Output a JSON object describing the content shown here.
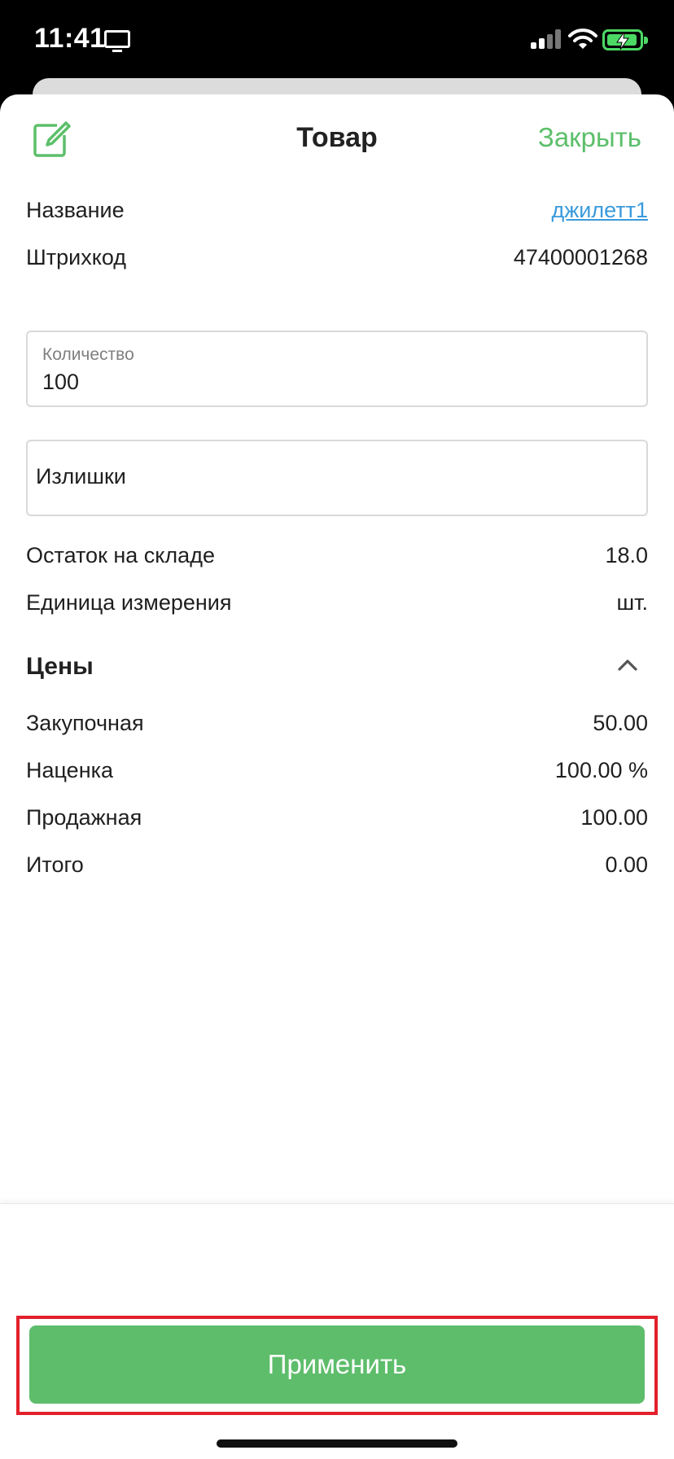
{
  "status_bar": {
    "time": "11:41",
    "battery_color": "#4cd964"
  },
  "header": {
    "title": "Товар",
    "close_label": "Закрыть",
    "accent_color": "#5cbf6a"
  },
  "product": {
    "name_label": "Название",
    "name_value": "джилетт1",
    "barcode_label": "Штрихкод",
    "barcode_value": "47400001268"
  },
  "quantity_field": {
    "label": "Количество",
    "value": "100"
  },
  "surplus_field": {
    "value": "Излишки"
  },
  "stock": {
    "label": "Остаток на складе",
    "value": "18.0"
  },
  "unit": {
    "label": "Единица измерения",
    "value": "шт."
  },
  "prices": {
    "title": "Цены",
    "items": [
      {
        "label": "Закупочная",
        "value": "50.00"
      },
      {
        "label": "Наценка",
        "value": "100.00 %"
      },
      {
        "label": "Продажная",
        "value": "100.00"
      },
      {
        "label": "Итого",
        "value": "0.00"
      }
    ]
  },
  "footer": {
    "apply_label": "Применить",
    "button_color": "#5ebd6b",
    "highlight_color": "#e3202b"
  }
}
